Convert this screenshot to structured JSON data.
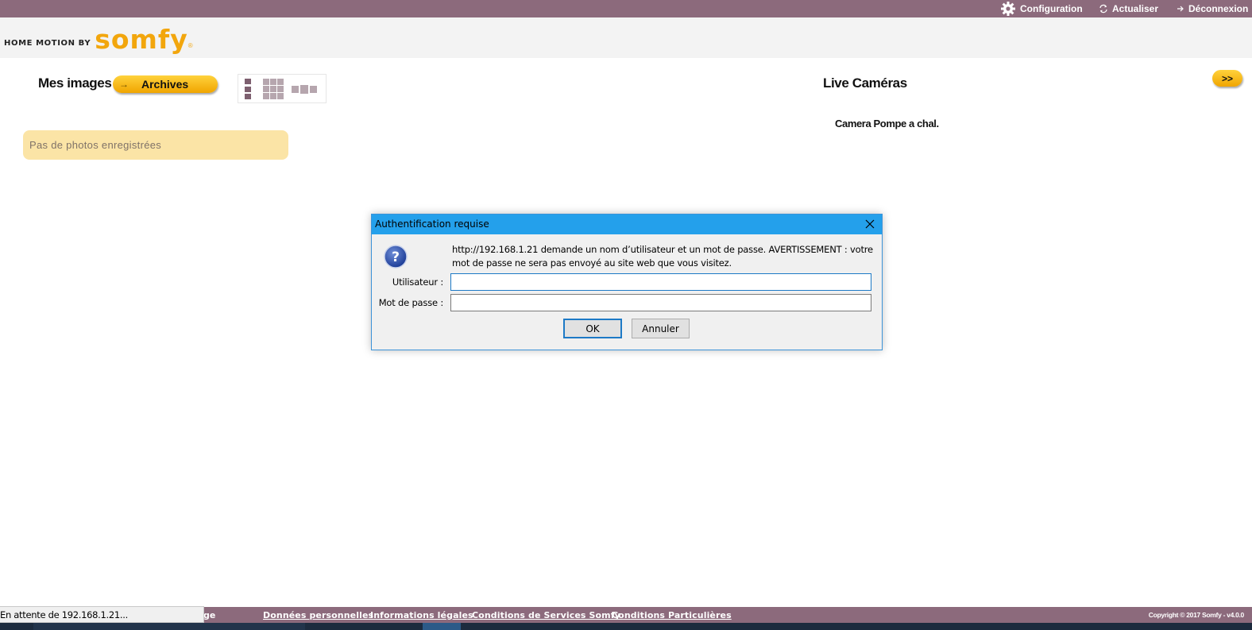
{
  "topbar": {
    "configuration_label": "Configuration",
    "actualiser_label": "Actualiser",
    "deconnexion_label": "Déconnexion"
  },
  "logo": {
    "small_text": "HOME MOTION BY",
    "brand_text": "somfy",
    "reg_mark": "®"
  },
  "left": {
    "title": "Mes images",
    "archives_arrow": "→",
    "archives_label": "Archives",
    "no_photos": "Pas de photos enregistrées"
  },
  "right": {
    "title": "Live Caméras",
    "expand_label": ">>",
    "camera_name": "Camera Pompe a chal."
  },
  "dialog": {
    "title": "Authentification requise",
    "message": "http://192.168.1.21 demande un nom d’utilisateur et un mot de passe. AVERTISSEMENT : votre mot de passe ne sera pas envoyé au site web que vous visitez.",
    "user_label": "Utilisateur :",
    "user_value": "",
    "pass_label": "Mot de passe :",
    "pass_value": "",
    "ok_label": "OK",
    "cancel_label": "Annuler"
  },
  "footer": {
    "partial_text": "ge",
    "links": [
      "Données personnelles",
      "Informations légales",
      "Conditions de Services Somfy",
      "Conditions Particulières"
    ],
    "copyright": "Copyright © 2017 Somfy - v4.0.0"
  },
  "statusbar": {
    "text": "En attente de 192.168.1.21..."
  },
  "colors": {
    "bar": "#8c6a7c",
    "accent": "#f2a60d",
    "dialog_titlebar": "#24a0eb",
    "no_photos_bg": "#fbe4a6"
  }
}
